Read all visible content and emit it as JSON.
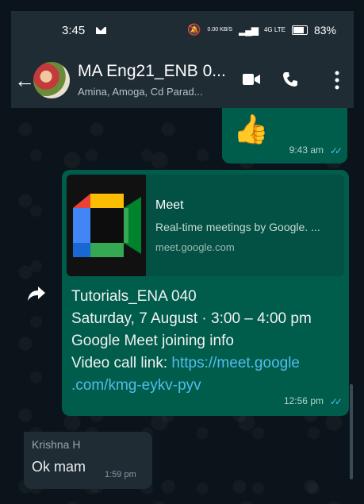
{
  "status_bar": {
    "time": "3:45",
    "speed": "0.00 KB/S",
    "network": "4G LTE",
    "battery": "83%"
  },
  "header": {
    "title": "MA Eng21_ENB 0...",
    "members": "Amina, Amoga, Cd Parad..."
  },
  "messages": {
    "thumb": {
      "emoji": "👍",
      "time": "9:43 am",
      "status": "read"
    },
    "link": {
      "preview_title": "Meet",
      "preview_desc": "Real-time meetings by Google. ...",
      "preview_domain": "meet.google.com",
      "line1": "Tutorials_ENA 040",
      "line2": "Saturday, 7 August · 3:00 – 4:00 pm",
      "line3": "Google Meet joining info",
      "line4_prefix": "Video call link: ",
      "line4_link": "https://meet.google",
      "line5_link": ".com/kmg-eykv-pyv",
      "time": "12:56 pm",
      "status": "read"
    },
    "incoming": {
      "sender": "Krishna H",
      "text": "Ok mam",
      "time": "1:59 pm"
    }
  },
  "icons": {
    "back": "arrow-left-icon",
    "video": "video-call-icon",
    "phone": "phone-icon",
    "more": "more-vert-icon",
    "forward": "forward-icon"
  },
  "colors": {
    "header": "#1f2c34",
    "outgoing_bubble": "#005c4b",
    "incoming_bubble": "#1f2c34",
    "link": "#53bdeb",
    "background": "#0b141a"
  }
}
